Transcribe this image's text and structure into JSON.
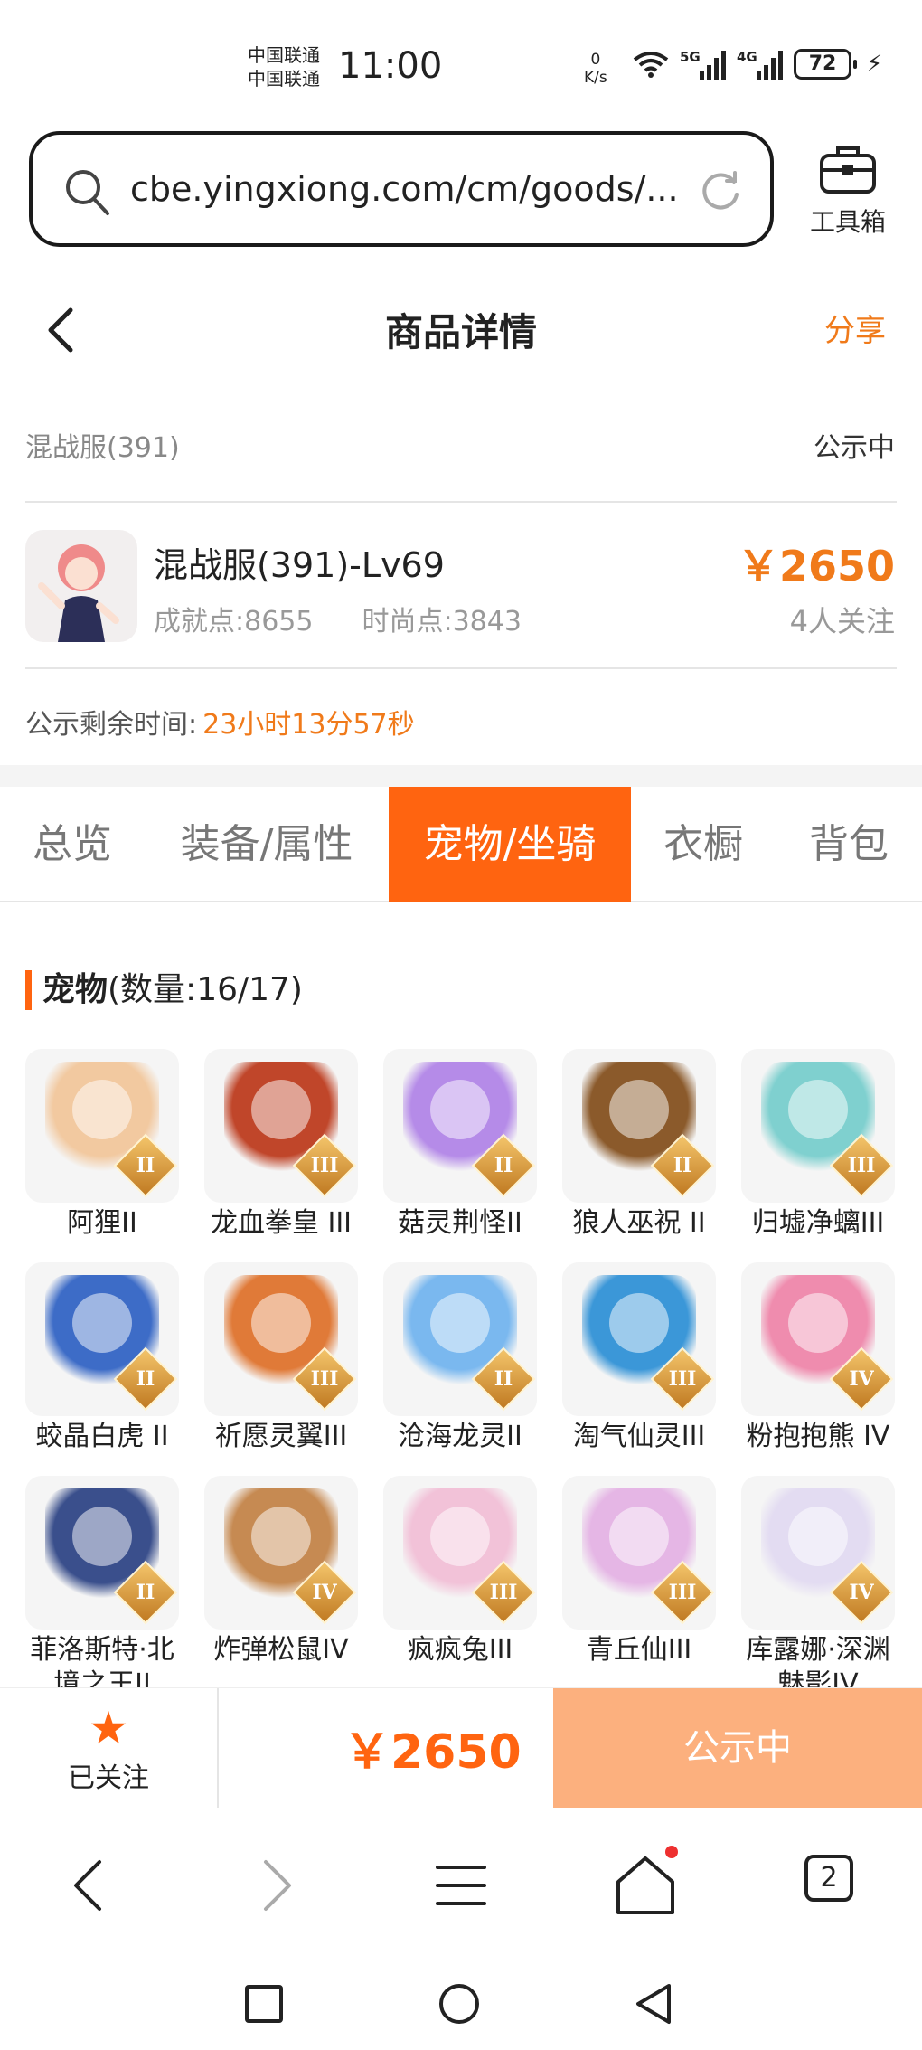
{
  "status_bar": {
    "carrier_1": "中国联通",
    "carrier_2": "中国联通",
    "time": "11:00",
    "net_speed_value": "0",
    "net_speed_unit": "K/s",
    "sig1_label": "5G",
    "sig2_label": "4G",
    "battery": "72"
  },
  "browser": {
    "url": "cbe.yingxiong.com/cm/goods/...",
    "toolbox_label": "工具箱",
    "tab_count": "2"
  },
  "header": {
    "title": "商品详情",
    "share": "分享"
  },
  "info": {
    "server": "混战服(391)",
    "status": "公示中",
    "char_title": "混战服(391)-Lv69",
    "achievement": "成就点:8655",
    "fashion": "时尚点:3843",
    "price": "￥2650",
    "followers": "4人关注",
    "countdown_label": "公示剩余时间:",
    "countdown_value": "23小时13分57秒"
  },
  "tabs": [
    {
      "label": "总览",
      "active": false
    },
    {
      "label": "装备/属性",
      "active": false
    },
    {
      "label": "宠物/坐骑",
      "active": true
    },
    {
      "label": "衣橱",
      "active": false
    },
    {
      "label": "背包",
      "active": false
    }
  ],
  "pets_section": {
    "title": "宠物",
    "count": "(数量:16/17)"
  },
  "pets": [
    {
      "name": "阿狸II",
      "rank": "II",
      "color": "#f2c9a0"
    },
    {
      "name": "龙血拳皇 III",
      "rank": "III",
      "color": "#c0462a"
    },
    {
      "name": "菇灵荆怪II",
      "rank": "II",
      "color": "#b58be8"
    },
    {
      "name": "狼人巫祝 II",
      "rank": "II",
      "color": "#8b5a2b"
    },
    {
      "name": "归墟净螭III",
      "rank": "III",
      "color": "#7fd0cf"
    },
    {
      "name": "蛟晶白虎 II",
      "rank": "II",
      "color": "#3d6cc7"
    },
    {
      "name": "祈愿灵翼III",
      "rank": "III",
      "color": "#e07a38"
    },
    {
      "name": "沧海龙灵II",
      "rank": "II",
      "color": "#7ab8ef"
    },
    {
      "name": "淘气仙灵III",
      "rank": "III",
      "color": "#3b97d8"
    },
    {
      "name": "粉抱抱熊 IV",
      "rank": "IV",
      "color": "#ef8cae"
    },
    {
      "name": "菲洛斯特·北境之王II",
      "rank": "II",
      "color": "#3a4f8c"
    },
    {
      "name": "炸弹松鼠IV",
      "rank": "IV",
      "color": "#c68a52"
    },
    {
      "name": "疯疯兔III",
      "rank": "III",
      "color": "#f2c2d8"
    },
    {
      "name": "青丘仙III",
      "rank": "III",
      "color": "#e5b6e5"
    },
    {
      "name": "库露娜·深渊魅影IV",
      "rank": "IV",
      "color": "#e3dcf2"
    }
  ],
  "action_bar": {
    "follow_label": "已关注",
    "price": "￥2650",
    "status_button": "公示中"
  },
  "colors": {
    "accent": "#ff6410",
    "accent_text": "#f07a1a",
    "status_button_bg": "#fcb07e"
  }
}
